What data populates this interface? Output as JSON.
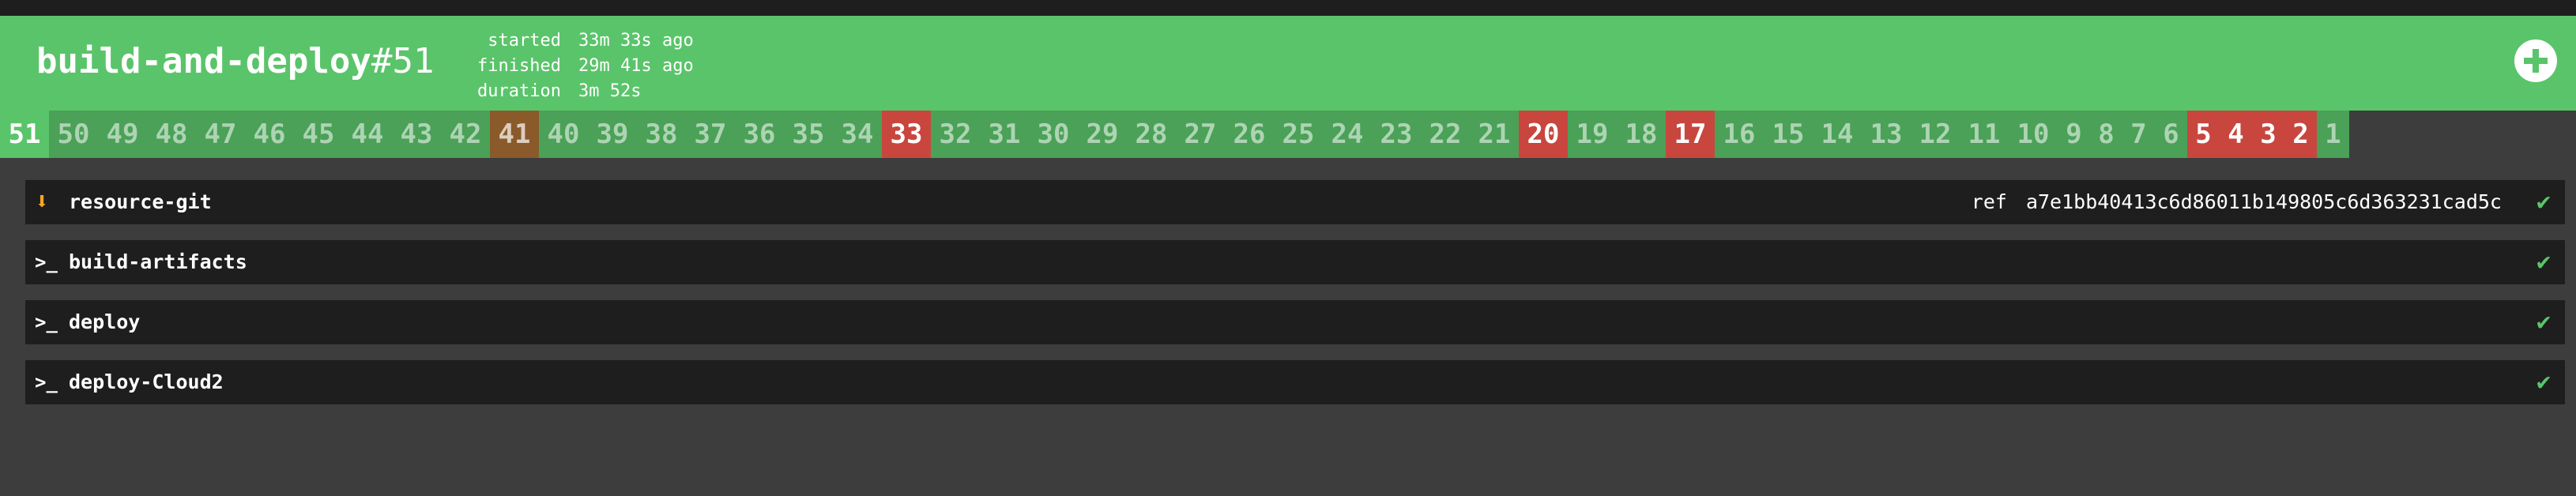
{
  "header": {
    "job_name": "build-and-deploy",
    "build_number": "#51",
    "times": [
      {
        "label": "started",
        "value": "33m 33s ago"
      },
      {
        "label": "finished",
        "value": "29m 41s ago"
      },
      {
        "label": "duration",
        "value": "3m 52s"
      }
    ],
    "add_icon": "plus-circle-icon",
    "status_color": "#5ac46a"
  },
  "builds": [
    {
      "label": "51",
      "status": "current"
    },
    {
      "label": "50",
      "status": "succeeded"
    },
    {
      "label": "49",
      "status": "succeeded"
    },
    {
      "label": "48",
      "status": "succeeded"
    },
    {
      "label": "47",
      "status": "succeeded"
    },
    {
      "label": "46",
      "status": "succeeded"
    },
    {
      "label": "45",
      "status": "succeeded"
    },
    {
      "label": "44",
      "status": "succeeded"
    },
    {
      "label": "43",
      "status": "succeeded"
    },
    {
      "label": "42",
      "status": "succeeded"
    },
    {
      "label": "41",
      "status": "aborted"
    },
    {
      "label": "40",
      "status": "succeeded"
    },
    {
      "label": "39",
      "status": "succeeded"
    },
    {
      "label": "38",
      "status": "succeeded"
    },
    {
      "label": "37",
      "status": "succeeded"
    },
    {
      "label": "36",
      "status": "succeeded"
    },
    {
      "label": "35",
      "status": "succeeded"
    },
    {
      "label": "34",
      "status": "succeeded"
    },
    {
      "label": "33",
      "status": "failed"
    },
    {
      "label": "32",
      "status": "succeeded"
    },
    {
      "label": "31",
      "status": "succeeded"
    },
    {
      "label": "30",
      "status": "succeeded"
    },
    {
      "label": "29",
      "status": "succeeded"
    },
    {
      "label": "28",
      "status": "succeeded"
    },
    {
      "label": "27",
      "status": "succeeded"
    },
    {
      "label": "26",
      "status": "succeeded"
    },
    {
      "label": "25",
      "status": "succeeded"
    },
    {
      "label": "24",
      "status": "succeeded"
    },
    {
      "label": "23",
      "status": "succeeded"
    },
    {
      "label": "22",
      "status": "succeeded"
    },
    {
      "label": "21",
      "status": "succeeded"
    },
    {
      "label": "20",
      "status": "failed"
    },
    {
      "label": "19",
      "status": "succeeded"
    },
    {
      "label": "18",
      "status": "succeeded"
    },
    {
      "label": "17",
      "status": "failed"
    },
    {
      "label": "16",
      "status": "succeeded"
    },
    {
      "label": "15",
      "status": "succeeded"
    },
    {
      "label": "14",
      "status": "succeeded"
    },
    {
      "label": "13",
      "status": "succeeded"
    },
    {
      "label": "12",
      "status": "succeeded"
    },
    {
      "label": "11",
      "status": "succeeded"
    },
    {
      "label": "10",
      "status": "succeeded"
    },
    {
      "label": "9",
      "status": "succeeded"
    },
    {
      "label": "8",
      "status": "succeeded"
    },
    {
      "label": "7",
      "status": "succeeded"
    },
    {
      "label": "6",
      "status": "succeeded"
    },
    {
      "label": "5",
      "status": "failed"
    },
    {
      "label": "4",
      "status": "failed"
    },
    {
      "label": "3",
      "status": "failed"
    },
    {
      "label": "2",
      "status": "failed"
    },
    {
      "label": "1",
      "status": "succeeded"
    }
  ],
  "steps": [
    {
      "name": "resource-git",
      "kind": "get",
      "icon": "arrow-down-icon",
      "ref_label": "ref",
      "ref_value": "a7e1bb40413c6d86011b149805c6d363231cad5c",
      "status": "succeeded"
    },
    {
      "name": "build-artifacts",
      "kind": "task",
      "icon": "terminal-icon",
      "status": "succeeded"
    },
    {
      "name": "deploy",
      "kind": "task",
      "icon": "terminal-icon",
      "status": "succeeded"
    },
    {
      "name": "deploy-Cloud2",
      "kind": "task",
      "icon": "terminal-icon",
      "status": "succeeded"
    }
  ]
}
